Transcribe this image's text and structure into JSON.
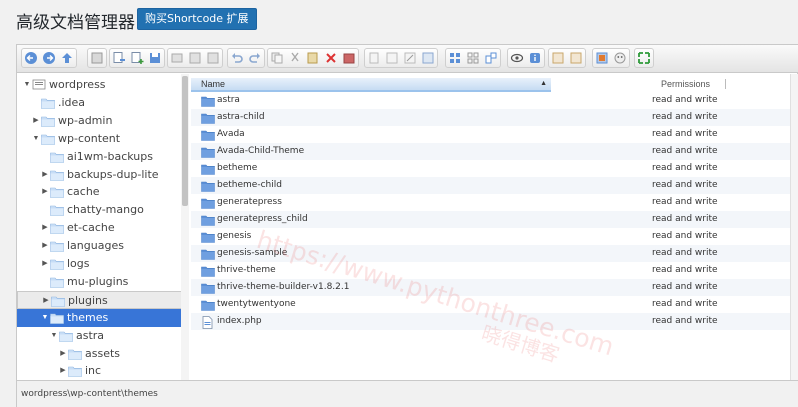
{
  "header": {
    "title": "高级文档管理器",
    "buy_button": "购买Shortcode 扩展"
  },
  "colors": {
    "accent": "#2271b1",
    "selected": "#3875d7",
    "folder": "#5b8fd6"
  },
  "toolbar": {
    "groups": [
      [
        "back-icon",
        "forward-icon",
        "up-icon"
      ],
      [
        "home-icon"
      ],
      [
        "copy-to-icon",
        "new-file-icon",
        "save-icon"
      ],
      [
        "open-icon",
        "info-icon",
        "reload-icon"
      ],
      [
        "undo-icon",
        "redo-icon"
      ],
      [
        "copy-icon",
        "cut-icon",
        "paste-icon",
        "delete-icon",
        "archive-icon"
      ],
      [
        "duplicate-icon",
        "rename-icon",
        "edit-icon",
        "resize-icon"
      ],
      [
        "icons-view-icon",
        "list-view-icon",
        "columns-view-icon"
      ],
      [
        "preview-icon",
        "help-info-icon"
      ],
      [
        "sort-asc-icon",
        "sort-desc-icon"
      ],
      [
        "extract-icon",
        "shortcut-icon"
      ],
      [
        "fullscreen-icon"
      ]
    ]
  },
  "tree": {
    "items": [
      {
        "label": "wordpress",
        "depth": 0,
        "arrow": "down",
        "root": true
      },
      {
        "label": ".idea",
        "depth": 1,
        "arrow": "none"
      },
      {
        "label": "wp-admin",
        "depth": 1,
        "arrow": "right"
      },
      {
        "label": "wp-content",
        "depth": 1,
        "arrow": "down"
      },
      {
        "label": "ai1wm-backups",
        "depth": 2,
        "arrow": "none"
      },
      {
        "label": "backups-dup-lite",
        "depth": 2,
        "arrow": "right"
      },
      {
        "label": "cache",
        "depth": 2,
        "arrow": "right"
      },
      {
        "label": "chatty-mango",
        "depth": 2,
        "arrow": "none"
      },
      {
        "label": "et-cache",
        "depth": 2,
        "arrow": "right"
      },
      {
        "label": "languages",
        "depth": 2,
        "arrow": "right"
      },
      {
        "label": "logs",
        "depth": 2,
        "arrow": "right"
      },
      {
        "label": "mu-plugins",
        "depth": 2,
        "arrow": "none"
      },
      {
        "label": "plugins",
        "depth": 2,
        "arrow": "right",
        "state": "hover"
      },
      {
        "label": "themes",
        "depth": 2,
        "arrow": "down",
        "state": "selected"
      },
      {
        "label": "astra",
        "depth": 3,
        "arrow": "down"
      },
      {
        "label": "assets",
        "depth": 4,
        "arrow": "right"
      },
      {
        "label": "inc",
        "depth": 4,
        "arrow": "right"
      }
    ]
  },
  "list": {
    "columns": {
      "name": "Name",
      "permissions": "Permissions"
    },
    "rows": [
      {
        "name": "astra",
        "perm": "read and write",
        "type": "folder"
      },
      {
        "name": "astra-child",
        "perm": "read and write",
        "type": "folder"
      },
      {
        "name": "Avada",
        "perm": "read and write",
        "type": "folder"
      },
      {
        "name": "Avada-Child-Theme",
        "perm": "read and write",
        "type": "folder"
      },
      {
        "name": "betheme",
        "perm": "read and write",
        "type": "folder"
      },
      {
        "name": "betheme-child",
        "perm": "read and write",
        "type": "folder"
      },
      {
        "name": "generatepress",
        "perm": "read and write",
        "type": "folder"
      },
      {
        "name": "generatepress_child",
        "perm": "read and write",
        "type": "folder"
      },
      {
        "name": "genesis",
        "perm": "read and write",
        "type": "folder"
      },
      {
        "name": "genesis-sample",
        "perm": "read and write",
        "type": "folder"
      },
      {
        "name": "thrive-theme",
        "perm": "read and write",
        "type": "folder"
      },
      {
        "name": "thrive-theme-builder-v1.8.2.1",
        "perm": "read and write",
        "type": "folder"
      },
      {
        "name": "twentytwentyone",
        "perm": "read and write",
        "type": "folder"
      },
      {
        "name": "index.php",
        "perm": "read and write",
        "type": "file"
      }
    ]
  },
  "status": {
    "path": "wordpress\\wp-content\\themes"
  },
  "watermark": {
    "url": "https://www.pythonthree.com",
    "name": "晓得博客"
  }
}
